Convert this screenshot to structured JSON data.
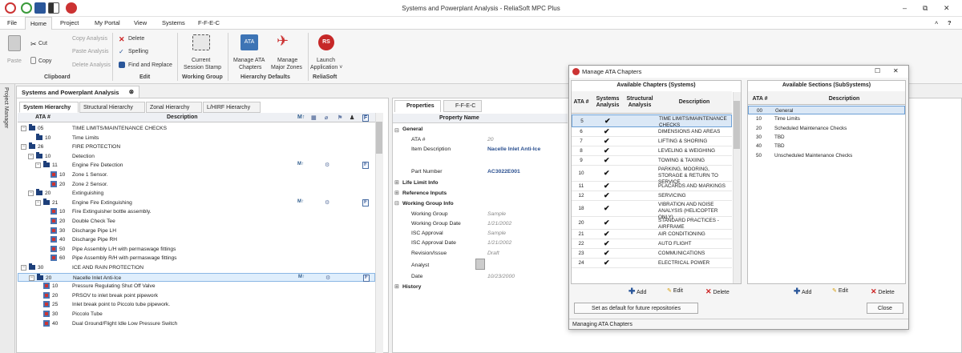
{
  "window": {
    "title": "Systems and Powerplant Analysis - ReliaSoft MPC Plus",
    "controls": [
      "–",
      "⧉",
      "✕"
    ],
    "help": [
      "˄",
      "?"
    ]
  },
  "menu": [
    "File",
    "Home",
    "Project",
    "My Portal",
    "View",
    "Systems",
    "F-F-E-C"
  ],
  "ribbon": {
    "clipboard": {
      "paste": "Paste",
      "cut": "Cut",
      "copy": "Copy",
      "copy_analysis": "Copy Analysis",
      "paste_analysis": "Paste Analysis",
      "delete_analysis": "Delete Analysis",
      "label": "Clipboard"
    },
    "edit": {
      "delete": "Delete",
      "spelling": "Spelling",
      "find_replace": "Find and Replace",
      "label": "Edit"
    },
    "working_group": {
      "current": "Current",
      "session": "Session Stamp",
      "label": "Working Group"
    },
    "hierarchy": {
      "manage_ata": "Manage ATA",
      "chapters": "Chapters",
      "manage": "Manage",
      "major_zones": "Major Zones",
      "label": "Hierarchy Defaults"
    },
    "reliasoft": {
      "launch": "Launch",
      "application": "Application ˅",
      "label": "ReliaSoft"
    }
  },
  "side_tab": "Project Manager",
  "doc_tab": "Systems and Powerplant Analysis",
  "tabs": [
    "System Hierarchy",
    "Structural Hierarchy",
    "Zonal Hierarchy",
    "L/HIRF Hierarchy"
  ],
  "hier_head": {
    "ata": "ATA #",
    "desc": "Description"
  },
  "hier_rows": [
    {
      "ata": "05",
      "desc": "TIME LIMITS/MAINTENANCE CHECKS"
    },
    {
      "ata": "10",
      "desc": "Time Limits"
    },
    {
      "ata": "26",
      "desc": "FIRE PROTECTION"
    },
    {
      "ata": "10",
      "desc": "Detection"
    },
    {
      "ata": "11",
      "desc": "Engine Fire Detection"
    },
    {
      "ata": "10",
      "desc": "Zone 1 Sensor."
    },
    {
      "ata": "20",
      "desc": "Zone 2 Sensor."
    },
    {
      "ata": "20",
      "desc": "Extinguishing"
    },
    {
      "ata": "21",
      "desc": "Engine Fire Extinguishing"
    },
    {
      "ata": "10",
      "desc": "Fire Extinguisher bottle assembly."
    },
    {
      "ata": "20",
      "desc": "Double Check Tee"
    },
    {
      "ata": "30",
      "desc": "Discharge Pipe LH"
    },
    {
      "ata": "40",
      "desc": "Discharge Pipe RH"
    },
    {
      "ata": "50",
      "desc": "Pipe Assembly L/H with permaswage fittings"
    },
    {
      "ata": "60",
      "desc": "Pipe Assembly R/H with permaswage fittings"
    },
    {
      "ata": "30",
      "desc": "ICE AND RAIN PROTECTION"
    },
    {
      "ata": "20",
      "desc": "Nacelle Inlet Anti-Ice"
    },
    {
      "ata": "10",
      "desc": "Pressure Regulating Shut Off Valve"
    },
    {
      "ata": "20",
      "desc": "PRSOV to inlet break point pipework"
    },
    {
      "ata": "25",
      "desc": "Inlet break point to Piccolo tube pipework."
    },
    {
      "ata": "30",
      "desc": "Piccolo Tube"
    },
    {
      "ata": "40",
      "desc": "Dual Ground/Flight Idle Low Pressure Switch"
    }
  ],
  "props": {
    "tab1": "Properties",
    "tab2": "F-F-E-C",
    "col": "Property Name",
    "general": "General",
    "ata": "ATA #",
    "ata_val": "20",
    "item": "Item Description",
    "item_val": "Nacelle Inlet Anti-Ice",
    "part": "Part Number",
    "part_val": "AC3022E001",
    "life": "Life Limit Info",
    "ref": "Reference Inputs",
    "wg": "Working Group Info",
    "wgroup": "Working Group",
    "wgroup_val": "Sample",
    "wgdate": "Working Group Date",
    "wgdate_val": "1/21/2002",
    "isc": "ISC Approval",
    "isc_val": "Sample",
    "iscdate": "ISC Approval Date",
    "iscdate_val": "1/21/2002",
    "rev": "Revision/Issue",
    "rev_val": "Draft",
    "analyst": "Analyst",
    "date": "Date",
    "date_val": "10/23/2000",
    "history": "History"
  },
  "dialog": {
    "title": "Manage ATA Chapters",
    "left_title": "Available Chapters (Systems)",
    "left_head": {
      "ata": "ATA #",
      "sys": "Systems Analysis",
      "str": "Structural Analysis",
      "desc": "Description"
    },
    "chapters": [
      {
        "ata": "5",
        "sys": "✔",
        "desc": "TIME LIMITS/MAINTENANCE CHECKS"
      },
      {
        "ata": "6",
        "sys": "✔",
        "desc": "DIMENSIONS AND AREAS"
      },
      {
        "ata": "7",
        "sys": "✔",
        "desc": "LIFTING & SHORING"
      },
      {
        "ata": "8",
        "sys": "✔",
        "desc": "LEVELING & WEIGHING"
      },
      {
        "ata": "9",
        "sys": "✔",
        "desc": "TOWING & TAXIING"
      },
      {
        "ata": "10",
        "sys": "✔",
        "desc": "PARKING, MOORING, STORAGE & RETURN TO SERVICE"
      },
      {
        "ata": "11",
        "sys": "✔",
        "desc": "PLACARDS AND MARKINGS"
      },
      {
        "ata": "12",
        "sys": "✔",
        "desc": "SERVICING"
      },
      {
        "ata": "18",
        "sys": "✔",
        "desc": "VIBRATION AND NOISE ANALYSIS (HELICOPTER ONLY)"
      },
      {
        "ata": "20",
        "sys": "✔",
        "desc": "STANDARD PRACTICES - AIRFRAME"
      },
      {
        "ata": "21",
        "sys": "✔",
        "desc": "AIR CONDITIONING"
      },
      {
        "ata": "22",
        "sys": "✔",
        "desc": "AUTO FLIGHT"
      },
      {
        "ata": "23",
        "sys": "✔",
        "desc": "COMMUNICATIONS"
      },
      {
        "ata": "24",
        "sys": "✔",
        "desc": "ELECTRICAL POWER"
      }
    ],
    "right_title": "Available Sections (SubSystems)",
    "right_head": {
      "ata": "ATA #",
      "desc": "Description"
    },
    "sections": [
      {
        "ata": "00",
        "desc": "General"
      },
      {
        "ata": "10",
        "desc": "Time Limits"
      },
      {
        "ata": "20",
        "desc": "Scheduled Maintenance Checks"
      },
      {
        "ata": "30",
        "desc": "TBD"
      },
      {
        "ata": "40",
        "desc": "TBD"
      },
      {
        "ata": "50",
        "desc": "Unscheduled Maintenance Checks"
      }
    ],
    "add": "Add",
    "edit": "Edit",
    "delete": "Delete",
    "set_default": "Set as default for future repositories",
    "close": "Close",
    "status": "Managing ATA Chapters"
  },
  "colors": {
    "accent": "#2b579a",
    "selection": "#dfeefc",
    "folder": "#1d3f7a"
  }
}
